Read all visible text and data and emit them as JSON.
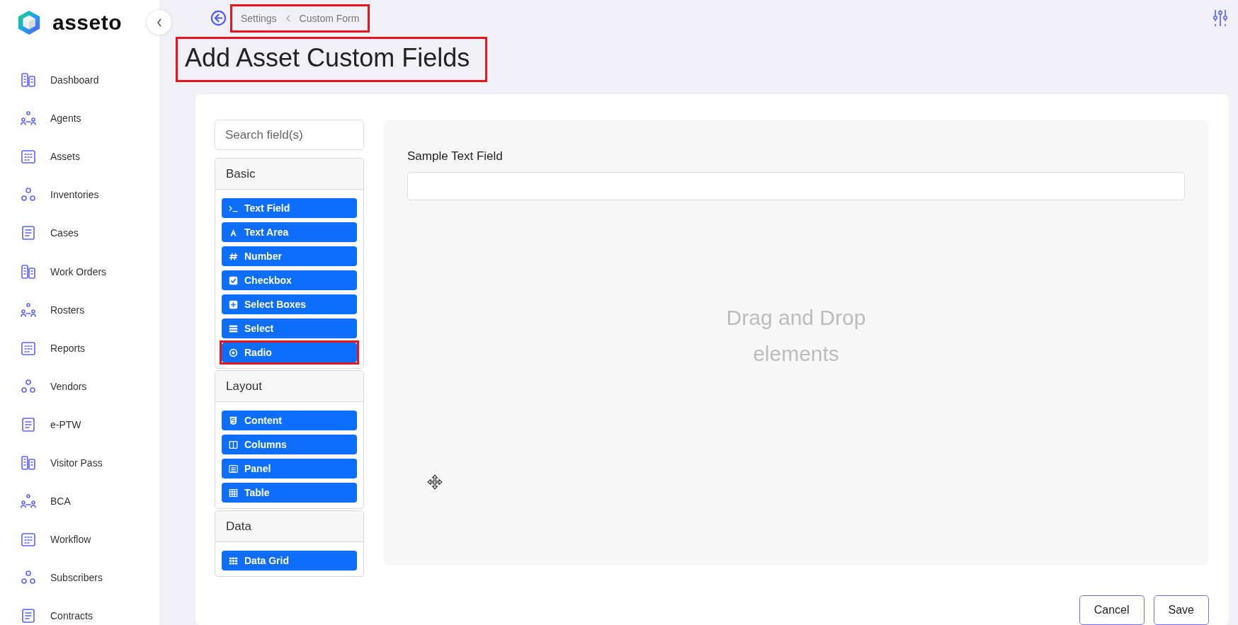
{
  "brand": {
    "name": "asseto"
  },
  "sidebar": {
    "items": [
      {
        "label": "Dashboard"
      },
      {
        "label": "Agents"
      },
      {
        "label": "Assets"
      },
      {
        "label": "Inventories"
      },
      {
        "label": "Cases"
      },
      {
        "label": "Work Orders"
      },
      {
        "label": "Rosters"
      },
      {
        "label": "Reports"
      },
      {
        "label": "Vendors"
      },
      {
        "label": "e-PTW"
      },
      {
        "label": "Visitor Pass"
      },
      {
        "label": "BCA"
      },
      {
        "label": "Workflow"
      },
      {
        "label": "Subscribers"
      },
      {
        "label": "Contracts"
      }
    ]
  },
  "breadcrumb": {
    "highlighted": true,
    "items": [
      {
        "label": "Settings"
      },
      {
        "label": "Custom Form"
      }
    ]
  },
  "page_title": {
    "text": "Add Asset Custom Fields",
    "highlighted": true
  },
  "search": {
    "placeholder": "Search field(s)"
  },
  "palette": [
    {
      "title": "Basic",
      "items": [
        {
          "label": "Text Field",
          "kind": "textfield",
          "highlighted": false
        },
        {
          "label": "Text Area",
          "kind": "textarea",
          "highlighted": false
        },
        {
          "label": "Number",
          "kind": "number",
          "highlighted": false
        },
        {
          "label": "Checkbox",
          "kind": "checkbox",
          "highlighted": false
        },
        {
          "label": "Select Boxes",
          "kind": "selectboxes",
          "highlighted": false
        },
        {
          "label": "Select",
          "kind": "select",
          "highlighted": false
        },
        {
          "label": "Radio",
          "kind": "radio",
          "highlighted": true
        }
      ]
    },
    {
      "title": "Layout",
      "items": [
        {
          "label": "Content",
          "kind": "content",
          "highlighted": false
        },
        {
          "label": "Columns",
          "kind": "columns",
          "highlighted": false
        },
        {
          "label": "Panel",
          "kind": "panel",
          "highlighted": false
        },
        {
          "label": "Table",
          "kind": "table",
          "highlighted": false
        }
      ]
    },
    {
      "title": "Data",
      "items": [
        {
          "label": "Data Grid",
          "kind": "datagrid",
          "highlighted": false
        }
      ]
    }
  ],
  "canvas": {
    "field_label": "Sample Text Field",
    "drop_hint": "Drag and Drop elements"
  },
  "buttons": [
    {
      "label": "Cancel"
    },
    {
      "label": "Save"
    }
  ]
}
